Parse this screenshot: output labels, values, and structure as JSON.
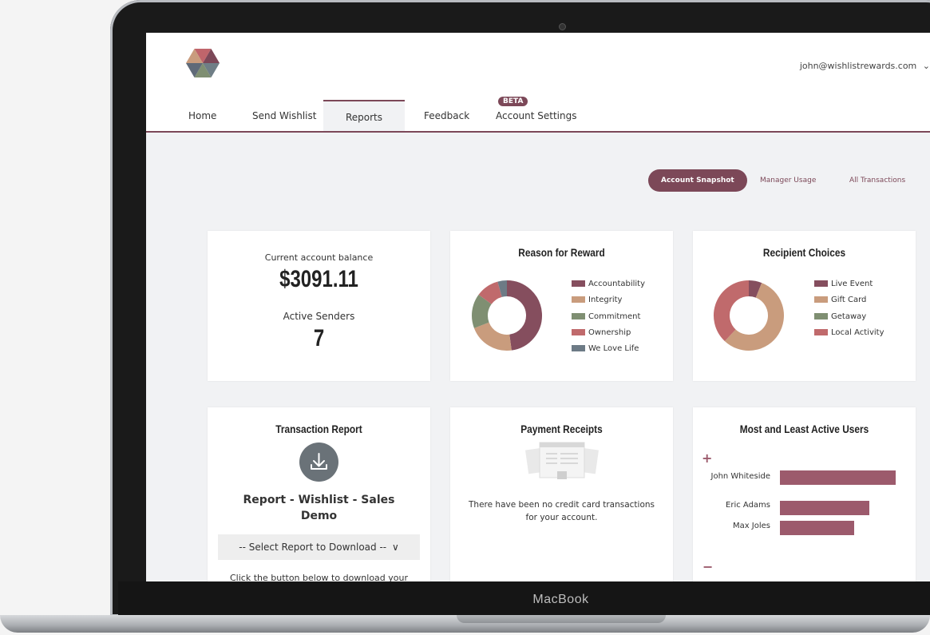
{
  "header": {
    "user_email": "john@wishlistrewards.com",
    "user_chevron": "⌄"
  },
  "nav": {
    "items": [
      {
        "label": "Home"
      },
      {
        "label": "Send Wishlist"
      },
      {
        "label": "Reports"
      },
      {
        "label": "Feedback"
      },
      {
        "label": "Account Settings"
      }
    ],
    "active": "Reports",
    "beta_badge": "BETA"
  },
  "subnav": {
    "items": [
      {
        "label": "Account Snapshot"
      },
      {
        "label": "Manager Usage"
      },
      {
        "label": "All Transactions"
      }
    ],
    "active": "Account Snapshot"
  },
  "balance_card": {
    "balance_label": "Current account balance",
    "balance_value": "$3091.11",
    "senders_label": "Active Senders",
    "senders_value": "7"
  },
  "reason_card": {
    "title": "Reason for Reward",
    "legend": [
      {
        "label": "Accountability",
        "color": "#854e5e",
        "value": 0.45
      },
      {
        "label": "Integrity",
        "color": "#c99c7d",
        "value": 0.2
      },
      {
        "label": "Commitment",
        "color": "#7f8f72",
        "value": 0.15
      },
      {
        "label": "Ownership",
        "color": "#c06a6c",
        "value": 0.1
      },
      {
        "label": "We Love Life",
        "color": "#6d7b86",
        "value": 0.04
      }
    ]
  },
  "choices_card": {
    "title": "Recipient Choices",
    "legend": [
      {
        "label": "Live Event",
        "color": "#854e5e",
        "value": 0.06
      },
      {
        "label": "Gift Card",
        "color": "#c99c7d",
        "value": 0.56
      },
      {
        "label": "Getaway",
        "color": "#7f8f72",
        "value": 0.0
      },
      {
        "label": "Local Activity",
        "color": "#c06a6c",
        "value": 0.38
      }
    ]
  },
  "transaction_card": {
    "title": "Transaction Report",
    "report_name": "Report - Wishlist - Sales Demo",
    "select_placeholder": "-- Select Report to Download --",
    "select_chevron": "∨",
    "hint": "Click the button below to download your"
  },
  "receipts_card": {
    "title": "Payment Receipts",
    "message": "There have been no credit card transactions for your account."
  },
  "users_card": {
    "title": "Most and Least Active Users",
    "plus_sign": "+",
    "minus_sign": "−",
    "users": [
      {
        "name": "John Whiteside",
        "value": 1.0
      },
      {
        "name": "Eric Adams",
        "value": 0.77
      },
      {
        "name": "Max Joles",
        "value": 0.64
      }
    ],
    "bar_color": "#9c5a6c"
  },
  "device": {
    "brand": "MacBook"
  }
}
